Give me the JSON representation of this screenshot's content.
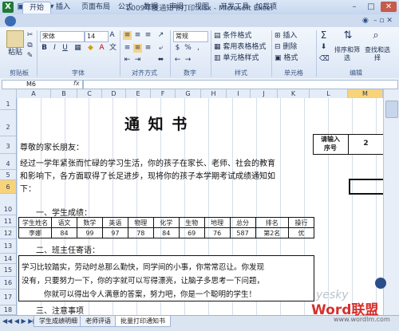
{
  "window": {
    "title": "2009年度通知书打印.xlsx - Microsoft Excel",
    "minimize": "–",
    "restore": "□",
    "close": "✕"
  },
  "ribbon_tabs": [
    "开始",
    "插入",
    "页面布局",
    "公式",
    "数据",
    "审阅",
    "视图",
    "开发工具",
    "加载项"
  ],
  "ribbon": {
    "paste": "粘贴",
    "clipboard": "剪贴板",
    "font_name": "宋体",
    "font_size": "14",
    "font_group": "字体",
    "align_group": "对齐方式",
    "number_group": "数字",
    "number_format": "常规",
    "cond_format": "条件格式",
    "table_format": "套用表格格式",
    "cell_style": "单元格样式",
    "styles_group": "样式",
    "insert": "插入",
    "delete": "删除",
    "format": "格式",
    "cells_group": "单元格",
    "sort_filter": "排序和筛选",
    "find_select": "查找和选择",
    "edit_group": "编辑"
  },
  "formula_bar": {
    "name_box": "M6",
    "fx": "fx"
  },
  "columns": [
    "A",
    "B",
    "C",
    "D",
    "E",
    "F",
    "G",
    "H",
    "I",
    "J",
    "K",
    "L",
    "M"
  ],
  "rows": [
    "1",
    "2",
    "3",
    "4",
    "5",
    "6",
    "10",
    "11",
    "12",
    "13",
    "14",
    "15",
    "16",
    "17",
    "18"
  ],
  "sheet": {
    "title": "通 知 书",
    "greeting": "尊敬的家长朋友：",
    "para1": "经过一学年紧张而忙碌的学习生活，你的孩子在家长、老师、社会的教育",
    "para2": "和影响下，各方面取得了长足进步，现将你的孩子本学期考试成绩通知如",
    "para3": "下：",
    "section1": "一、学生成绩：",
    "section2": "二、班主任寄语：",
    "section3": "三、注意事项",
    "input_label_line1": "请输入",
    "input_label_line2": "序号",
    "input_value": "2",
    "score_headers": [
      "学生姓名",
      "语文",
      "数学",
      "英语",
      "物理",
      "化学",
      "生物",
      "地理",
      "总分",
      "排名",
      "操行"
    ],
    "score_values": [
      "李娜",
      "84",
      "99",
      "97",
      "78",
      "84",
      "69",
      "76",
      "587",
      "第2名",
      "优"
    ],
    "comment1": "学习比较踏实，劳动时总那么勤快，同学间的小事，你常常忍让。你发现",
    "comment2": "没有，只要努力一下，你的字就可以写得漂亮，让脑子多思考一下问题，",
    "comment3": "你就可以得出令人满意的答案，努力吧，你是一个聪明的学生！"
  },
  "sheet_tabs": [
    "学生成绩明细",
    "老师评语",
    "批量打印通知书"
  ],
  "watermark": {
    "brand": "Word联盟",
    "url": "www.wordlm.com",
    "yesky": "yesky"
  }
}
